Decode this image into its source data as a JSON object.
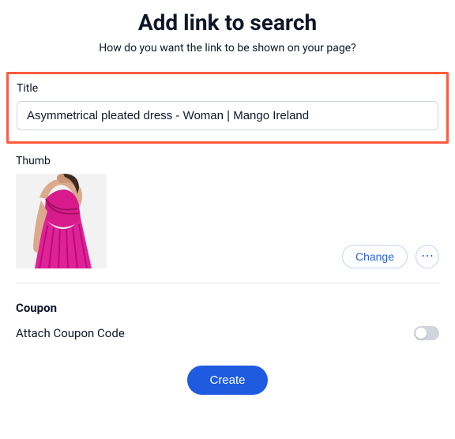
{
  "header": {
    "title": "Add link to search",
    "subtitle": "How do you want the link to be shown on your page?"
  },
  "titleField": {
    "label": "Title",
    "value": "Asymmetrical pleated dress - Woman | Mango Ireland"
  },
  "thumb": {
    "label": "Thumb",
    "changeLabel": "Change",
    "moreLabel": "⋯"
  },
  "coupon": {
    "heading": "Coupon",
    "attachLabel": "Attach Coupon Code",
    "enabled": false
  },
  "actions": {
    "create": "Create"
  }
}
